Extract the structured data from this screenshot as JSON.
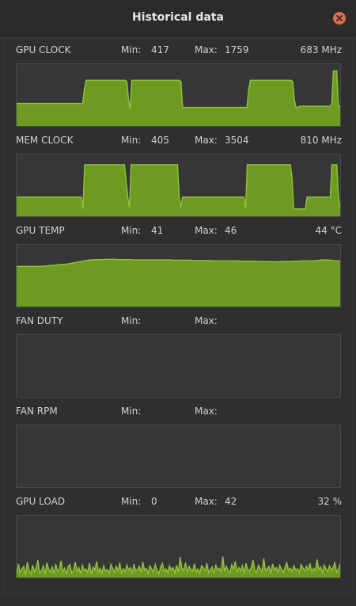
{
  "window": {
    "title": "Historical data"
  },
  "accent_color": "#6e9a22",
  "line_color": "#8fc43a",
  "metrics": [
    {
      "id": "gpu-clock",
      "name": "GPU CLOCK",
      "min_label": "Min:",
      "min_value": "417",
      "max_label": "Max:",
      "max_value": "1759",
      "current": "683 MHz"
    },
    {
      "id": "mem-clock",
      "name": "MEM CLOCK",
      "min_label": "Min:",
      "min_value": "405",
      "max_label": "Max:",
      "max_value": "3504",
      "current": "810 MHz"
    },
    {
      "id": "gpu-temp",
      "name": "GPU TEMP",
      "min_label": "Min:",
      "min_value": "41",
      "max_label": "Max:",
      "max_value": "46",
      "current": "44 °C"
    },
    {
      "id": "fan-duty",
      "name": "FAN DUTY",
      "min_label": "Min:",
      "min_value": "",
      "max_label": "Max:",
      "max_value": "",
      "current": ""
    },
    {
      "id": "fan-rpm",
      "name": "FAN RPM",
      "min_label": "Min:",
      "min_value": "",
      "max_label": "Max:",
      "max_value": "",
      "current": ""
    },
    {
      "id": "gpu-load",
      "name": "GPU LOAD",
      "min_label": "Min:",
      "min_value": "0",
      "max_label": "Max:",
      "max_value": "42",
      "current": "32 %"
    }
  ],
  "chart_data": [
    {
      "type": "area",
      "name": "GPU CLOCK",
      "ylim": [
        0,
        2000
      ],
      "values": [
        730,
        730,
        730,
        730,
        730,
        730,
        730,
        730,
        730,
        730,
        730,
        730,
        730,
        730,
        730,
        730,
        730,
        730,
        730,
        730,
        730,
        730,
        730,
        730,
        730,
        730,
        730,
        730,
        730,
        730,
        730,
        730,
        730,
        730,
        730,
        730,
        730,
        730,
        730,
        730,
        1180,
        1480,
        1480,
        1480,
        1480,
        1480,
        1480,
        1480,
        1480,
        1480,
        1480,
        1480,
        1480,
        1480,
        1480,
        1480,
        1480,
        1480,
        1480,
        1480,
        1480,
        1480,
        1480,
        1480,
        1480,
        1450,
        900,
        520,
        1480,
        1480,
        1480,
        1480,
        1480,
        1480,
        1480,
        1480,
        1480,
        1480,
        1480,
        1480,
        1480,
        1480,
        1480,
        1480,
        1480,
        1480,
        1480,
        1480,
        1480,
        1480,
        1480,
        1480,
        1480,
        1480,
        1480,
        1480,
        1480,
        1440,
        600,
        600,
        600,
        600,
        600,
        600,
        600,
        600,
        600,
        600,
        600,
        600,
        600,
        600,
        600,
        600,
        600,
        600,
        600,
        600,
        600,
        600,
        600,
        600,
        600,
        600,
        600,
        600,
        600,
        600,
        600,
        600,
        600,
        600,
        600,
        600,
        600,
        600,
        600,
        1180,
        1480,
        1480,
        1480,
        1480,
        1480,
        1480,
        1480,
        1480,
        1480,
        1480,
        1480,
        1480,
        1480,
        1480,
        1480,
        1480,
        1480,
        1480,
        1480,
        1480,
        1480,
        1480,
        1480,
        1480,
        1480,
        1440,
        820,
        600,
        600,
        640,
        640,
        640,
        640,
        640,
        640,
        640,
        640,
        640,
        640,
        640,
        640,
        640,
        640,
        640,
        640,
        640,
        640,
        640,
        700,
        1780,
        1780,
        1780,
        650,
        620
      ]
    },
    {
      "type": "area",
      "name": "MEM CLOCK",
      "ylim": [
        0,
        4200
      ],
      "values": [
        1300,
        1300,
        1300,
        1300,
        1300,
        1300,
        1300,
        1300,
        1300,
        1300,
        1300,
        1300,
        1300,
        1300,
        1300,
        1300,
        1300,
        1300,
        1300,
        1300,
        1300,
        1300,
        1300,
        1300,
        1300,
        1300,
        1300,
        1300,
        1300,
        1300,
        1300,
        1300,
        1300,
        1300,
        1300,
        1300,
        1300,
        1300,
        1300,
        1300,
        500,
        3500,
        3500,
        3500,
        3500,
        3500,
        3500,
        3500,
        3500,
        3500,
        3500,
        3500,
        3500,
        3500,
        3500,
        3500,
        3500,
        3500,
        3500,
        3500,
        3500,
        3500,
        3500,
        3500,
        3500,
        3500,
        2400,
        1300,
        600,
        3500,
        3500,
        3500,
        3500,
        3500,
        3500,
        3500,
        3500,
        3500,
        3500,
        3500,
        3500,
        3500,
        3500,
        3500,
        3500,
        3500,
        3500,
        3500,
        3500,
        3500,
        3500,
        3500,
        3500,
        3500,
        3500,
        3500,
        3500,
        3500,
        1300,
        600,
        1300,
        1300,
        1300,
        1300,
        1300,
        1300,
        1300,
        1300,
        1300,
        1300,
        1300,
        1300,
        1300,
        1300,
        1300,
        1300,
        1300,
        1300,
        1300,
        1300,
        1300,
        1300,
        1300,
        1300,
        1300,
        1300,
        1300,
        1300,
        1300,
        1300,
        1300,
        1300,
        1300,
        1300,
        1300,
        1300,
        1300,
        1300,
        500,
        3500,
        3500,
        3500,
        3500,
        3500,
        3500,
        3500,
        3500,
        3500,
        3500,
        3500,
        3500,
        3500,
        3500,
        3500,
        3500,
        3500,
        3500,
        3500,
        3500,
        3500,
        3500,
        3500,
        3500,
        3500,
        3500,
        3500,
        2600,
        500,
        500,
        500,
        500,
        500,
        500,
        500,
        500,
        1300,
        1300,
        1300,
        1300,
        1300,
        1300,
        1300,
        1300,
        1300,
        1300,
        1300,
        1300,
        1300,
        1300,
        1300,
        3500,
        3500,
        3500,
        3500,
        1300,
        500
      ]
    },
    {
      "type": "area",
      "name": "GPU TEMP",
      "ylim": [
        30,
        50
      ],
      "values": [
        43,
        43,
        43,
        43,
        43,
        43,
        43,
        43,
        43.1,
        43.2,
        43.3,
        43.4,
        43.5,
        43.6,
        43.7,
        43.8,
        44.0,
        44.2,
        44.4,
        44.6,
        44.8,
        45.0,
        45.1,
        45.2,
        45.2,
        45.2,
        45.3,
        45.3,
        45.3,
        45.3,
        45.2,
        45.2,
        45.2,
        45.2,
        45.1,
        45.1,
        45.1,
        45.1,
        45.1,
        45.1,
        45.1,
        45.1,
        45.1,
        45.1,
        45.1,
        45.1,
        45.0,
        45.0,
        45.0,
        45.0,
        45.0,
        45.0,
        44.9,
        44.9,
        44.9,
        44.9,
        44.9,
        44.9,
        44.8,
        44.8,
        44.8,
        44.8,
        44.8,
        44.8,
        44.8,
        44.8,
        44.7,
        44.7,
        44.7,
        44.7,
        44.7,
        44.6,
        44.6,
        44.6,
        44.6,
        44.5,
        44.5,
        44.5,
        44.6,
        44.6,
        44.6,
        44.7,
        44.7,
        44.7,
        44.8,
        44.8,
        44.8,
        44.8,
        44.9,
        45.0,
        45.1,
        45.1,
        45.0,
        44.9,
        44.8,
        44.7
      ]
    },
    {
      "type": "area",
      "name": "FAN DUTY",
      "values": []
    },
    {
      "type": "area",
      "name": "FAN RPM",
      "values": []
    },
    {
      "type": "area",
      "name": "GPU LOAD",
      "ylim": [
        0,
        100
      ],
      "values": [
        5,
        22,
        8,
        14,
        18,
        4,
        25,
        12,
        6,
        20,
        9,
        16,
        28,
        7,
        11,
        19,
        5,
        24,
        14,
        9,
        17,
        6,
        22,
        10,
        13,
        27,
        8,
        15,
        5,
        18,
        21,
        7,
        12,
        25,
        9,
        16,
        6,
        20,
        11,
        14,
        8,
        23,
        5,
        17,
        12,
        26,
        9,
        15,
        7,
        19,
        10,
        13,
        6,
        21,
        15,
        8,
        18,
        11,
        24,
        7,
        14,
        9,
        20,
        12,
        16,
        6,
        22,
        10,
        13,
        18,
        8,
        25,
        11,
        15,
        7,
        19,
        14,
        9,
        21,
        12,
        6,
        17,
        23,
        10,
        14,
        8,
        19,
        12,
        16,
        7,
        20,
        9,
        33,
        15,
        11,
        24,
        8,
        18,
        13,
        10,
        22,
        9,
        14,
        7,
        19,
        16,
        11,
        23,
        8,
        13,
        17,
        6,
        21,
        12,
        15,
        9,
        34,
        10,
        18,
        12,
        8,
        21,
        14,
        26,
        9,
        16,
        11,
        19,
        7,
        23,
        13,
        10,
        17,
        28,
        12,
        8,
        20,
        15,
        9,
        31,
        11,
        14,
        18,
        7,
        22,
        12,
        16,
        9,
        20,
        13,
        8,
        17,
        24,
        11,
        15,
        9,
        19,
        12,
        14,
        8,
        21,
        16,
        10,
        18,
        12,
        23,
        9,
        15,
        11,
        29,
        13,
        17,
        8,
        20,
        14,
        10,
        19,
        12,
        16,
        24,
        9,
        13,
        22
      ]
    }
  ]
}
